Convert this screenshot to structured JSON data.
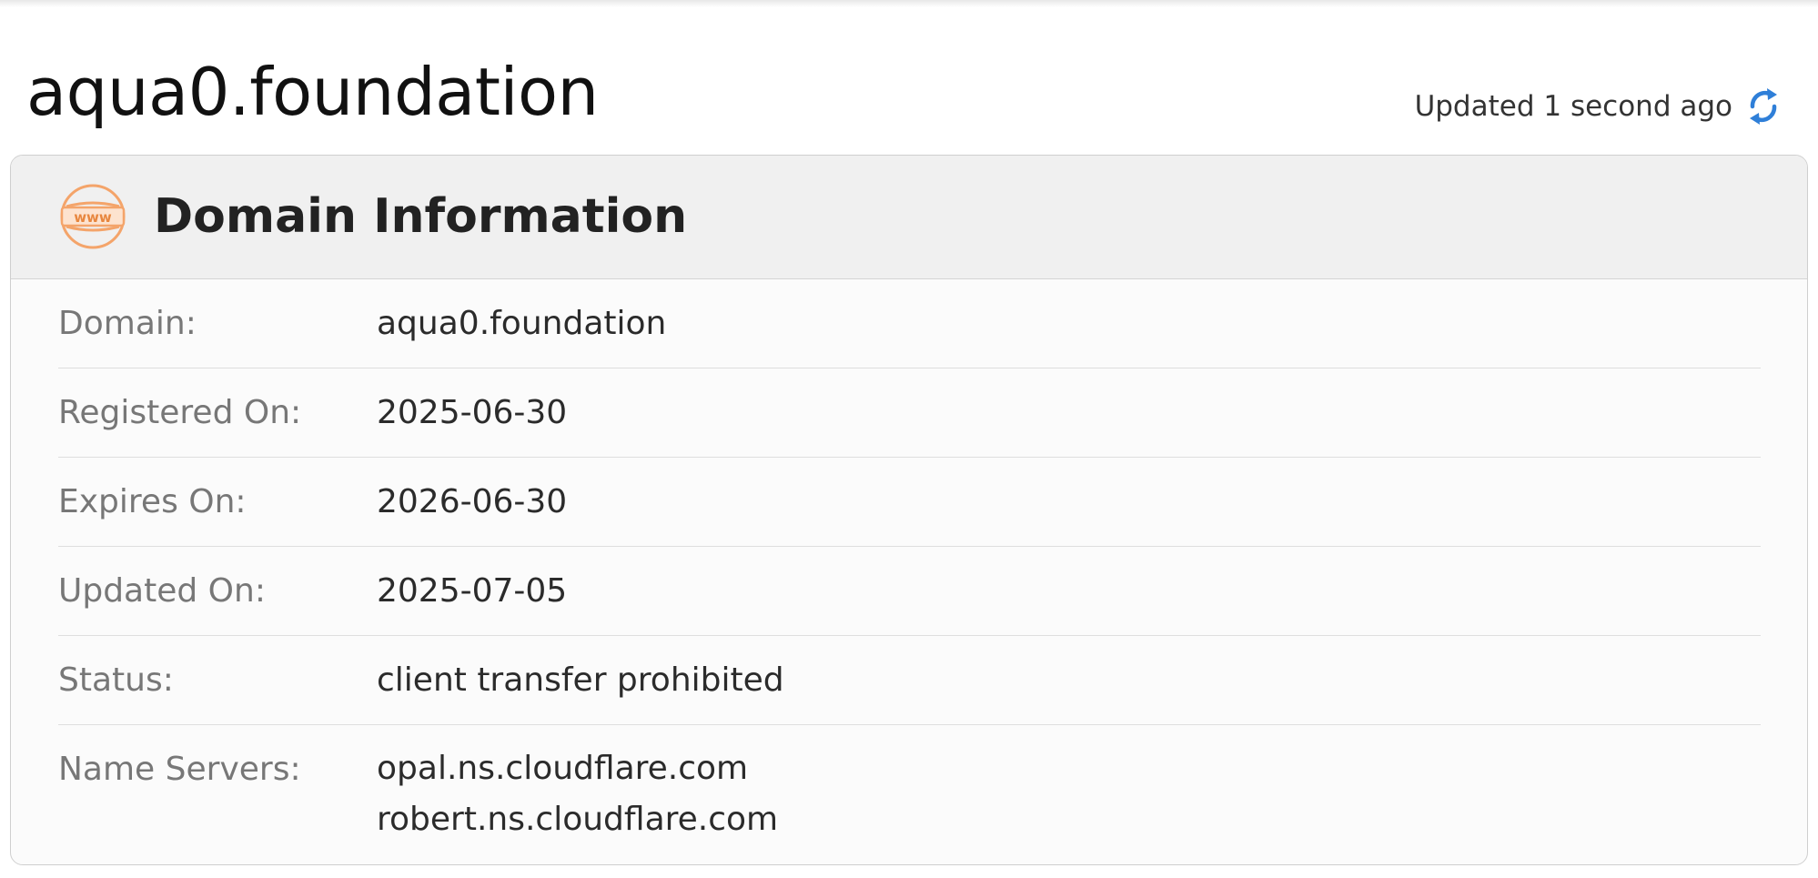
{
  "page": {
    "title": "aqua0.foundation",
    "updated_text": "Updated 1 second ago",
    "refresh_icon": "refresh-icon"
  },
  "card": {
    "title": "Domain Information",
    "icon": "www-globe-icon",
    "icon_text": "www",
    "accent_color": "#f4a46a",
    "refresh_color": "#2f7fd8",
    "rows": [
      {
        "label": "Domain:",
        "value": "aqua0.foundation"
      },
      {
        "label": "Registered On:",
        "value": "2025-06-30"
      },
      {
        "label": "Expires On:",
        "value": "2026-06-30"
      },
      {
        "label": "Updated On:",
        "value": "2025-07-05"
      },
      {
        "label": "Status:",
        "value": "client transfer prohibited"
      }
    ],
    "name_servers": {
      "label": "Name Servers:",
      "values": [
        "opal.ns.cloudflare.com",
        "robert.ns.cloudflare.com"
      ]
    }
  }
}
